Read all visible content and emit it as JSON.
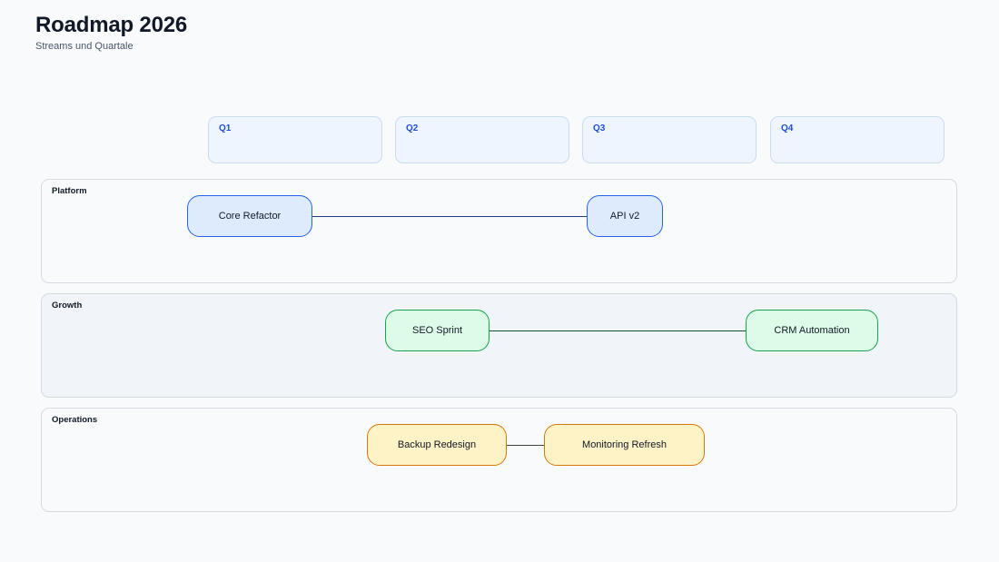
{
  "header": {
    "title": "Roadmap 2026",
    "subtitle": "Streams und Quartale"
  },
  "quarters": [
    {
      "label": "Q1"
    },
    {
      "label": "Q2"
    },
    {
      "label": "Q3"
    },
    {
      "label": "Q4"
    }
  ],
  "lanes": [
    {
      "label": "Platform",
      "color": {
        "fill": "#deebfd",
        "border": "#2563eb",
        "line": "#1e3a8a"
      },
      "items": [
        {
          "label": "Core Refactor"
        },
        {
          "label": "API v2"
        }
      ]
    },
    {
      "label": "Growth",
      "color": {
        "fill": "#dcfce7",
        "border": "#16a34a",
        "line": "#14532d"
      },
      "items": [
        {
          "label": "SEO Sprint"
        },
        {
          "label": "CRM Automation"
        }
      ]
    },
    {
      "label": "Operations",
      "color": {
        "fill": "#fef3c7",
        "border": "#d97706",
        "line": "#44403c"
      },
      "items": [
        {
          "label": "Backup Redesign"
        },
        {
          "label": "Monitoring Refresh"
        }
      ]
    }
  ]
}
